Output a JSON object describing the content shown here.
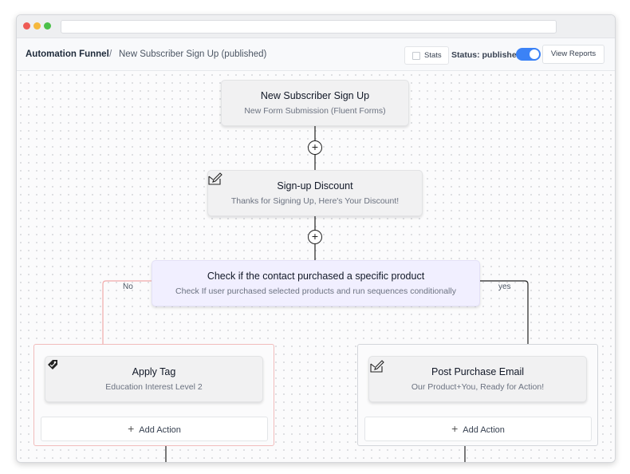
{
  "window": {
    "url": ""
  },
  "header": {
    "breadcrumb_main": "Automation Funnel",
    "breadcrumb_sep": "/",
    "breadcrumb_sub": "New Subscriber Sign Up (published)",
    "stats_label": "Stats",
    "status_label": "Status: published",
    "status_on": true,
    "reports_label": "View Reports"
  },
  "flow": {
    "trigger": {
      "title": "New Subscriber Sign Up",
      "subtitle": "New Form Submission (Fluent Forms)"
    },
    "email1": {
      "title": "Sign-up Discount",
      "subtitle": "Thanks for Signing Up, Here's Your Discount!",
      "icon": "email-edit-icon"
    },
    "condition": {
      "title": "Check if the contact purchased a specific product",
      "subtitle": "Check If user purchased selected products and run sequences conditionally"
    },
    "branch_no": {
      "label": "No",
      "action_title": "Apply Tag",
      "action_subtitle": "Education Interest Level 2",
      "icon": "tag-icon",
      "add_label": "Add Action"
    },
    "branch_yes": {
      "label": "yes",
      "action_title": "Post Purchase Email",
      "action_subtitle": "Our Product+You, Ready for Action!",
      "icon": "email-edit-icon",
      "add_label": "Add Action"
    }
  },
  "colors": {
    "accent": "#3b82f6",
    "no_branch": "#f1bcbc",
    "condition_bg": "#f1efff"
  }
}
